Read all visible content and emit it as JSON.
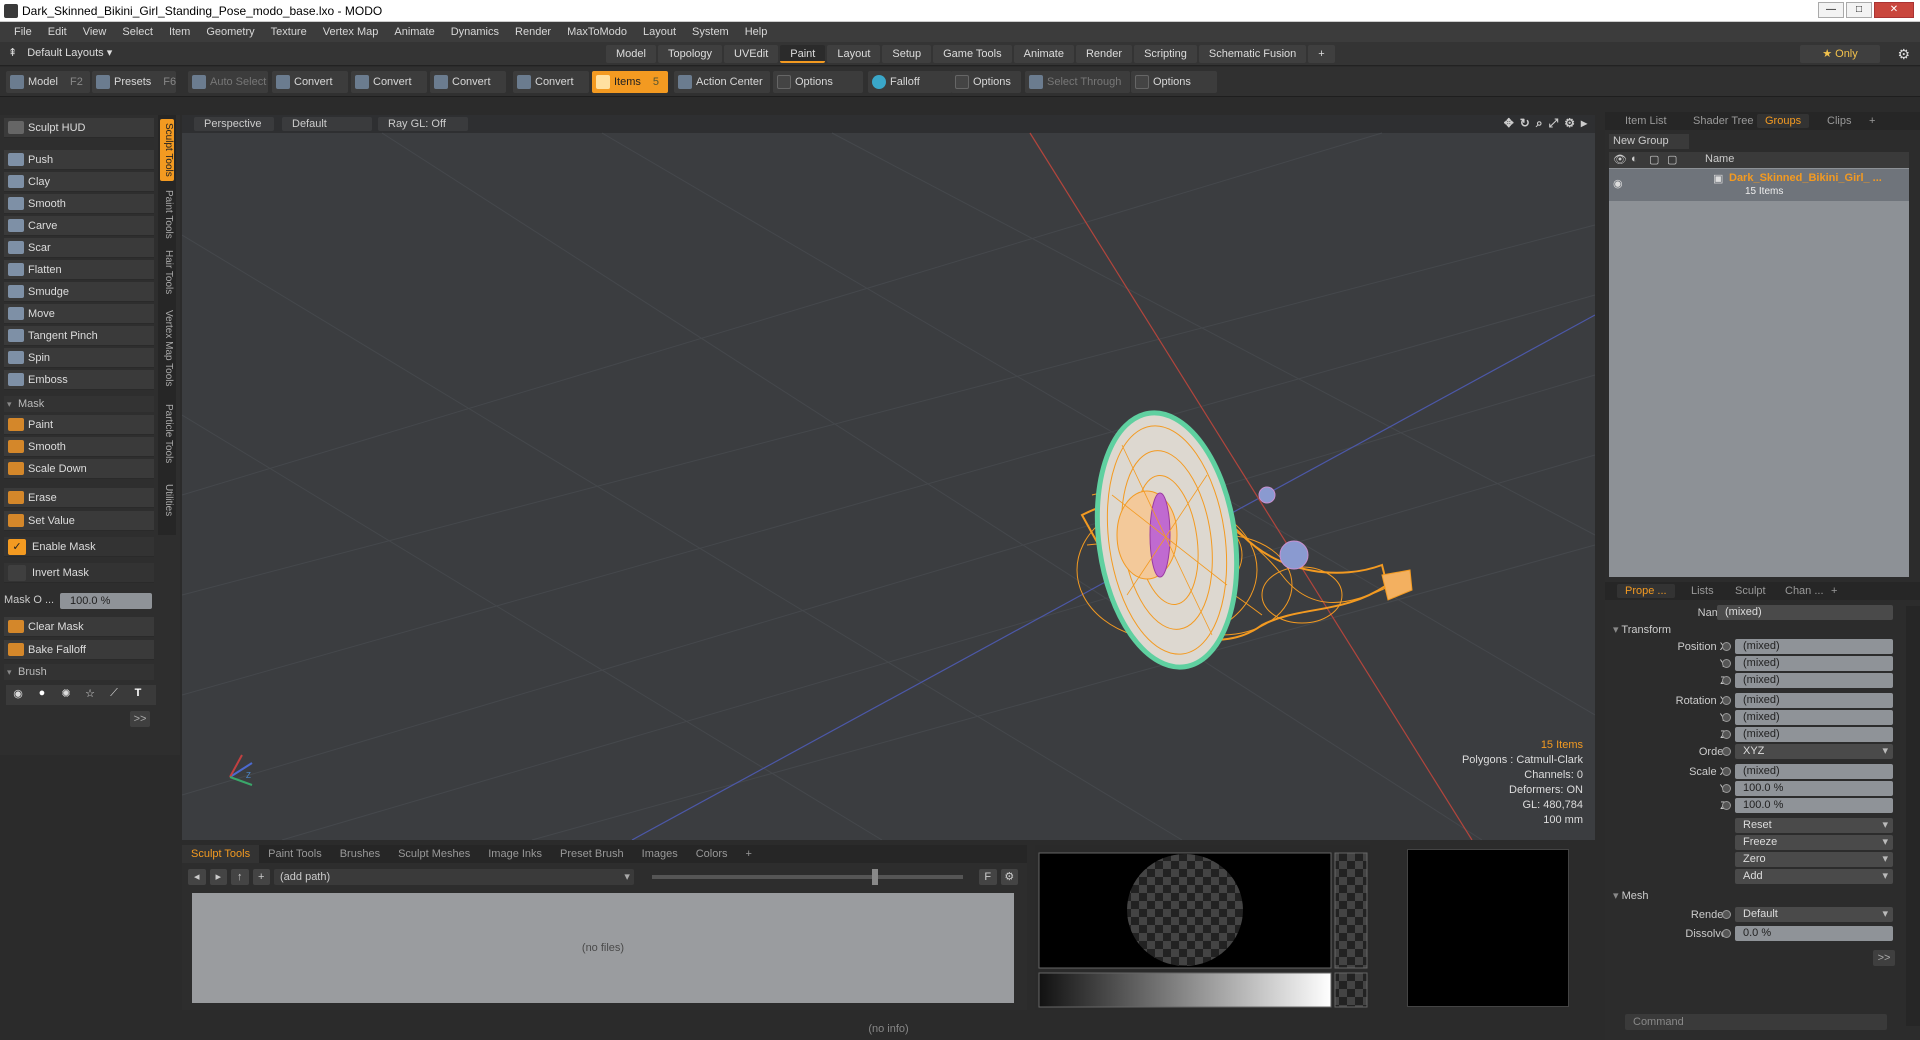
{
  "window": {
    "title": "Dark_Skinned_Bikini_Girl_Standing_Pose_modo_base.lxo - MODO",
    "minimize": "—",
    "maximize": "□",
    "close": "✕"
  },
  "menu": [
    "File",
    "Edit",
    "View",
    "Select",
    "Item",
    "Geometry",
    "Texture",
    "Vertex Map",
    "Animate",
    "Dynamics",
    "Render",
    "MaxToModo",
    "Layout",
    "System",
    "Help"
  ],
  "layoutbar": {
    "layouts_label": "Default Layouts ▾",
    "tabs": [
      "Model",
      "Topology",
      "UVEdit",
      "Paint",
      "Layout",
      "Setup",
      "Game Tools",
      "Animate",
      "Render",
      "Scripting",
      "Schematic Fusion",
      "+"
    ],
    "active_tab": "Paint",
    "only_label": "★  Only",
    "gear": "⚙"
  },
  "toolbar": {
    "model": "Model",
    "model_key": "F2",
    "presets": "Presets",
    "presets_key": "F6",
    "auto_select": "Auto Select",
    "convert1": "Convert",
    "convert2": "Convert",
    "convert3": "Convert",
    "convert4": "Convert",
    "items": "Items",
    "items_key": "5",
    "action_center": "Action Center",
    "options1": "Options",
    "falloff": "Falloff",
    "options2": "Options",
    "select_through": "Select Through",
    "options3": "Options"
  },
  "left_panel": {
    "hud": "Sculpt HUD",
    "tools": [
      "Push",
      "Clay",
      "Smooth",
      "Carve",
      "Scar",
      "Flatten",
      "Smudge",
      "Move",
      "Tangent Pinch",
      "Spin",
      "Emboss"
    ],
    "mask_header": "Mask",
    "mask_tools": [
      "Paint",
      "Smooth",
      "Scale Down"
    ],
    "erase": "Erase",
    "set_value": "Set Value",
    "enable_mask": "Enable Mask",
    "invert_mask": "Invert Mask",
    "mask_opacity_label": "Mask O ...",
    "mask_opacity_value": "100.0 %",
    "clear_mask": "Clear Mask",
    "bake_falloff": "Bake Falloff",
    "brush_header": "Brush",
    "more": ">>",
    "vertical_tabs": [
      "Sculpt Tools",
      "Paint Tools",
      "Hair Tools",
      "Vertex Map Tools",
      "Particle Tools",
      "Utilities"
    ]
  },
  "viewport": {
    "view": "Perspective",
    "shading": "Default",
    "raygl": "Ray GL: Off",
    "stats": {
      "items": "15 Items",
      "polygons": "Polygons : Catmull-Clark",
      "channels": "Channels: 0",
      "deformers": "Deformers: ON",
      "gl": "GL: 480,784",
      "scale": "100 mm"
    }
  },
  "bottom_panel": {
    "tabs": [
      "Sculpt Tools",
      "Paint Tools",
      "Brushes",
      "Sculpt Meshes",
      "Image Inks",
      "Preset Brush",
      "Images",
      "Colors",
      "+"
    ],
    "path": "(add path)",
    "nofiles": "(no files)",
    "f_btn": "F"
  },
  "status": "(no info)",
  "right_panel": {
    "tabs": [
      "Item List",
      "Shader Tree",
      "Groups",
      "Clips",
      "+"
    ],
    "active_tab": "Groups",
    "new_group": "New Group",
    "col_name": "Name",
    "group_name": "Dark_Skinned_Bikini_Girl_ ...",
    "group_count": "15 Items",
    "prop_tabs": [
      "Prope ...",
      "Lists",
      "Sculpt",
      "Chan ...",
      "+"
    ],
    "name_label": "Name",
    "name_value": "(mixed)",
    "transform": "Transform",
    "pos_x": "Position X",
    "rot_x": "Rotation X",
    "scale_x": "Scale X",
    "y": "Y",
    "z": "Z",
    "order": "Order",
    "mixed": "(mixed)",
    "order_value": "XYZ",
    "scale_yz": "100.0 %",
    "reset": "Reset",
    "freeze": "Freeze",
    "zero": "Zero",
    "add": "Add",
    "mesh": "Mesh",
    "render_label": "Render",
    "render_value": "Default",
    "dissolve_label": "Dissolve",
    "dissolve_value": "0.0 %",
    "more": ">>",
    "command": "Command"
  }
}
